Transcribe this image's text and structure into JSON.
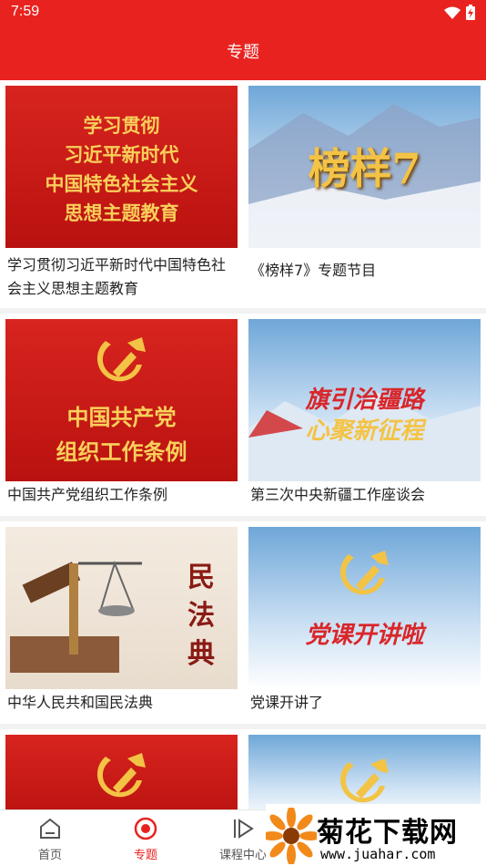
{
  "status_bar": {
    "time": "7:59",
    "wifi_icon": "wifi-icon",
    "battery_icon": "battery-icon"
  },
  "header": {
    "title": "专题"
  },
  "cards": [
    {
      "caption": "学习贯彻习近平新时代中国特色社会主义思想主题教育",
      "thumb_lines": [
        "学习贯彻",
        "习近平新时代",
        "中国特色社会主义",
        "思想主题教育"
      ]
    },
    {
      "caption": "《榜样7》专题节目",
      "thumb_lines": [
        "榜样7"
      ]
    },
    {
      "caption": "中国共产党组织工作条例",
      "thumb_lines": [
        "中国共产党",
        "组织工作条例"
      ]
    },
    {
      "caption": "第三次中央新疆工作座谈会",
      "thumb_lines": [
        "旗引治疆路",
        "心聚新征程"
      ]
    },
    {
      "caption": "中华人民共和国民法典",
      "thumb_lines": [
        "民",
        "法",
        "典"
      ]
    },
    {
      "caption": "党课开讲了",
      "thumb_lines": [
        "党课开讲啦"
      ]
    }
  ],
  "bottom_nav": [
    {
      "label": "首页",
      "icon": "home-icon",
      "active": false
    },
    {
      "label": "专题",
      "icon": "record-icon",
      "active": true
    },
    {
      "label": "课程中心",
      "icon": "play-icon",
      "active": false
    }
  ],
  "watermark": {
    "title": "菊花下载网",
    "url": "www.juahar.com"
  },
  "colors": {
    "primary": "#e8231f",
    "gold": "#f9d05a"
  }
}
